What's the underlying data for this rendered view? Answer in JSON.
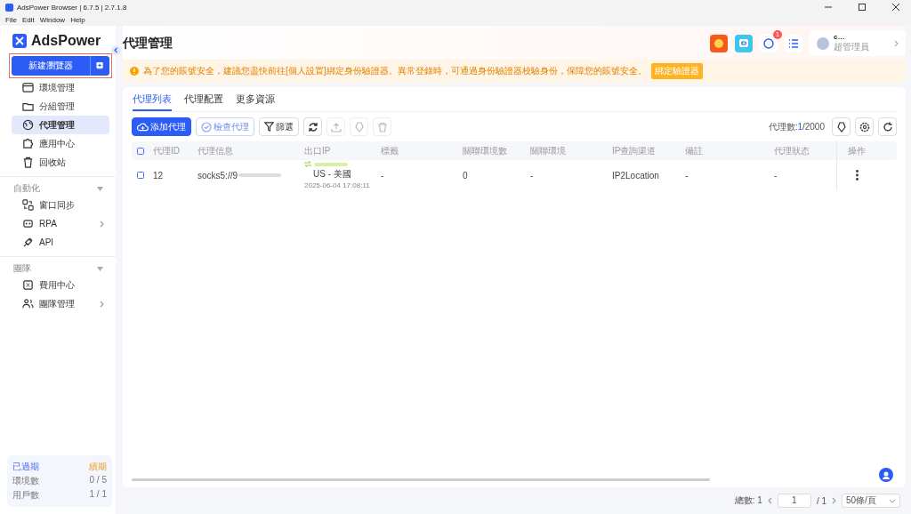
{
  "window": {
    "title": "AdsPower Browser | 6.7.5 | 2.7.1.8"
  },
  "menu": [
    "File",
    "Edit",
    "Window",
    "Help"
  ],
  "sidebar": {
    "brand": "AdsPower",
    "new_button": "新建瀏覽器",
    "groups": [
      {
        "items": [
          {
            "label": "環境管理",
            "selected": false,
            "arrow": false
          },
          {
            "label": "分組管理",
            "selected": false,
            "arrow": false
          },
          {
            "label": "代理管理",
            "selected": true,
            "arrow": false
          },
          {
            "label": "應用中心",
            "selected": false,
            "arrow": false
          },
          {
            "label": "回收站",
            "selected": false,
            "arrow": false
          }
        ]
      },
      {
        "heading": "自動化",
        "expanded": true,
        "items": [
          {
            "label": "窗口同步",
            "selected": false,
            "arrow": false
          },
          {
            "label": "RPA",
            "selected": false,
            "arrow": true
          },
          {
            "label": "API",
            "selected": false,
            "arrow": false
          }
        ]
      },
      {
        "heading": "團隊",
        "expanded": true,
        "items": [
          {
            "label": "費用中心",
            "selected": false,
            "arrow": false
          },
          {
            "label": "團隊管理",
            "selected": false,
            "arrow": true
          }
        ]
      }
    ],
    "plan": {
      "status": "已過期",
      "renew": "續期",
      "stats": [
        {
          "label": "環境數",
          "value": "0 / 5"
        },
        {
          "label": "用戶數",
          "value": "1 / 1"
        }
      ]
    }
  },
  "header": {
    "title": "代理管理",
    "notification_count": "1",
    "user": {
      "name": "c…",
      "role": "超管理員"
    }
  },
  "notice": {
    "text": "為了您的賬號安全，建議您盡快前往[個人設置]綁定身份驗證器。異常登錄時，可通過身份驗證器校驗身份，保障您的賬號安全。",
    "button": "綁定驗證器"
  },
  "tabs": [
    {
      "label": "代理列表",
      "selected": true
    },
    {
      "label": "代理配置",
      "selected": false
    },
    {
      "label": "更多資源",
      "selected": false
    }
  ],
  "toolbar": {
    "add": "添加代理",
    "check": "檢查代理",
    "filter": "篩選",
    "proxy_count": {
      "label": "代理數:",
      "current": "1",
      "total": "/2000"
    }
  },
  "table": {
    "all_checked": false,
    "columns": [
      "代理ID",
      "代理信息",
      "出口IP",
      "標籤",
      "關聯環境數",
      "關聯環境",
      "IP查詢渠道",
      "備註",
      "代理狀态",
      "操作"
    ],
    "rows": [
      {
        "checked": false,
        "id": "12",
        "info": "socks5://9",
        "region": "US - 美國",
        "time": "2025-06-04 17:08:11",
        "tag": "-",
        "env_count": "0",
        "env": "-",
        "channel": "IP2Location",
        "note": "-",
        "status": "-"
      }
    ]
  },
  "pagination": {
    "total": "總數: 1",
    "page": "1",
    "pages": "/ 1",
    "page_size": "50條/頁"
  }
}
